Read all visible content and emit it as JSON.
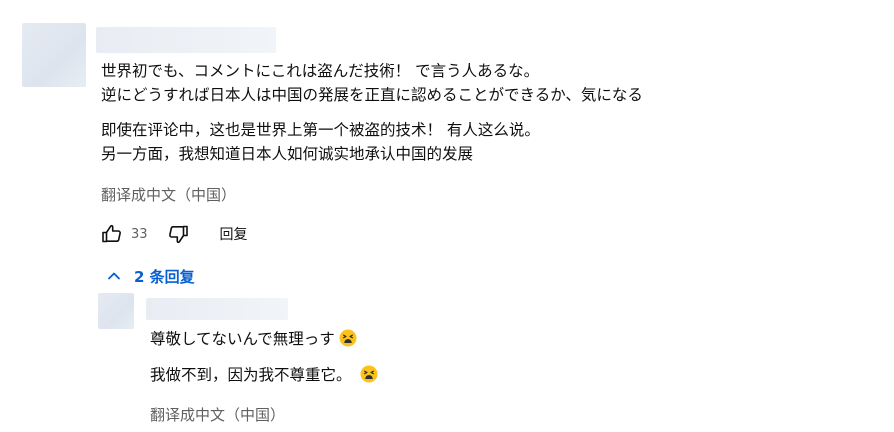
{
  "comment": {
    "lines": [
      "世界初でも、コメントにこれは盗んだ技術！ で言う人あるな。",
      "逆にどうすれば日本人は中国の発展を正直に認めることができるか、気になる"
    ],
    "translation_lines": [
      "即使在评论中，这也是世界上第一个被盗的技术！ 有人这么说。",
      "另一方面，我想知道日本人如何诚实地承认中国的发展"
    ],
    "translate_label": "翻译成中文（中国）",
    "like_count": "33",
    "reply_label": "回复",
    "icons": {
      "like": "thumbs-up-icon",
      "dislike": "thumbs-down-icon"
    }
  },
  "replies_toggle": {
    "label": "2 条回复",
    "icon": "chevron-up-icon",
    "color": "#065fd4"
  },
  "reply": {
    "line": "尊敬してないんで無理っす",
    "translation_line": "我做不到，因为我不尊重它。",
    "translate_label": "翻译成中文（中国）",
    "emoji": "tired-face-emoji"
  }
}
